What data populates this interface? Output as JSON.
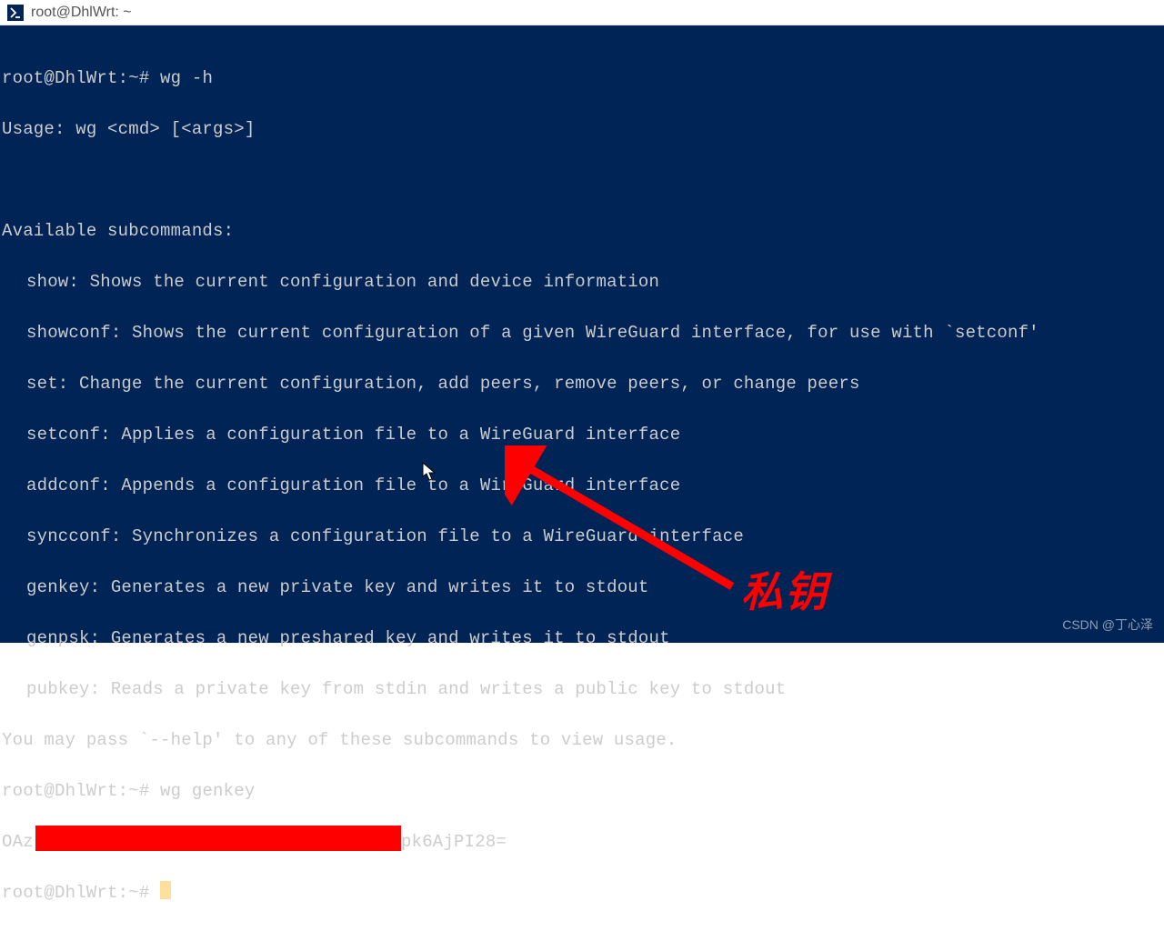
{
  "window": {
    "title": "root@DhlWrt: ~"
  },
  "terminal": {
    "prompt1": "root@DhlWrt:~# ",
    "cmd1": "wg -h",
    "usage": "Usage: wg <cmd> [<args>]",
    "blank": " ",
    "avail": "Available subcommands:",
    "sub_show": "show: Shows the current configuration and device information",
    "sub_showconf": "showconf: Shows the current configuration of a given WireGuard interface, for use with `setconf'",
    "sub_set": "set: Change the current configuration, add peers, remove peers, or change peers",
    "sub_setconf": "setconf: Applies a configuration file to a WireGuard interface",
    "sub_addconf": "addconf: Appends a configuration file to a WireGuard interface",
    "sub_syncconf": "syncconf: Synchronizes a configuration file to a WireGuard interface",
    "sub_genkey": "genkey: Generates a new private key and writes it to stdout",
    "sub_genpsk": "genpsk: Generates a new preshared key and writes it to stdout",
    "sub_pubkey": "pubkey: Reads a private key from stdin and writes a public key to stdout",
    "help_note": "You may pass `--help' to any of these subcommands to view usage.",
    "prompt2": "root@DhlWrt:~# ",
    "cmd2": "wg genkey",
    "key_prefix": "OAz",
    "key_suffix": "pk6AjPI28=",
    "prompt3": "root@DhlWrt:~# "
  },
  "annotation": {
    "label": "私钥"
  },
  "watermark": "CSDN @丁心泽"
}
